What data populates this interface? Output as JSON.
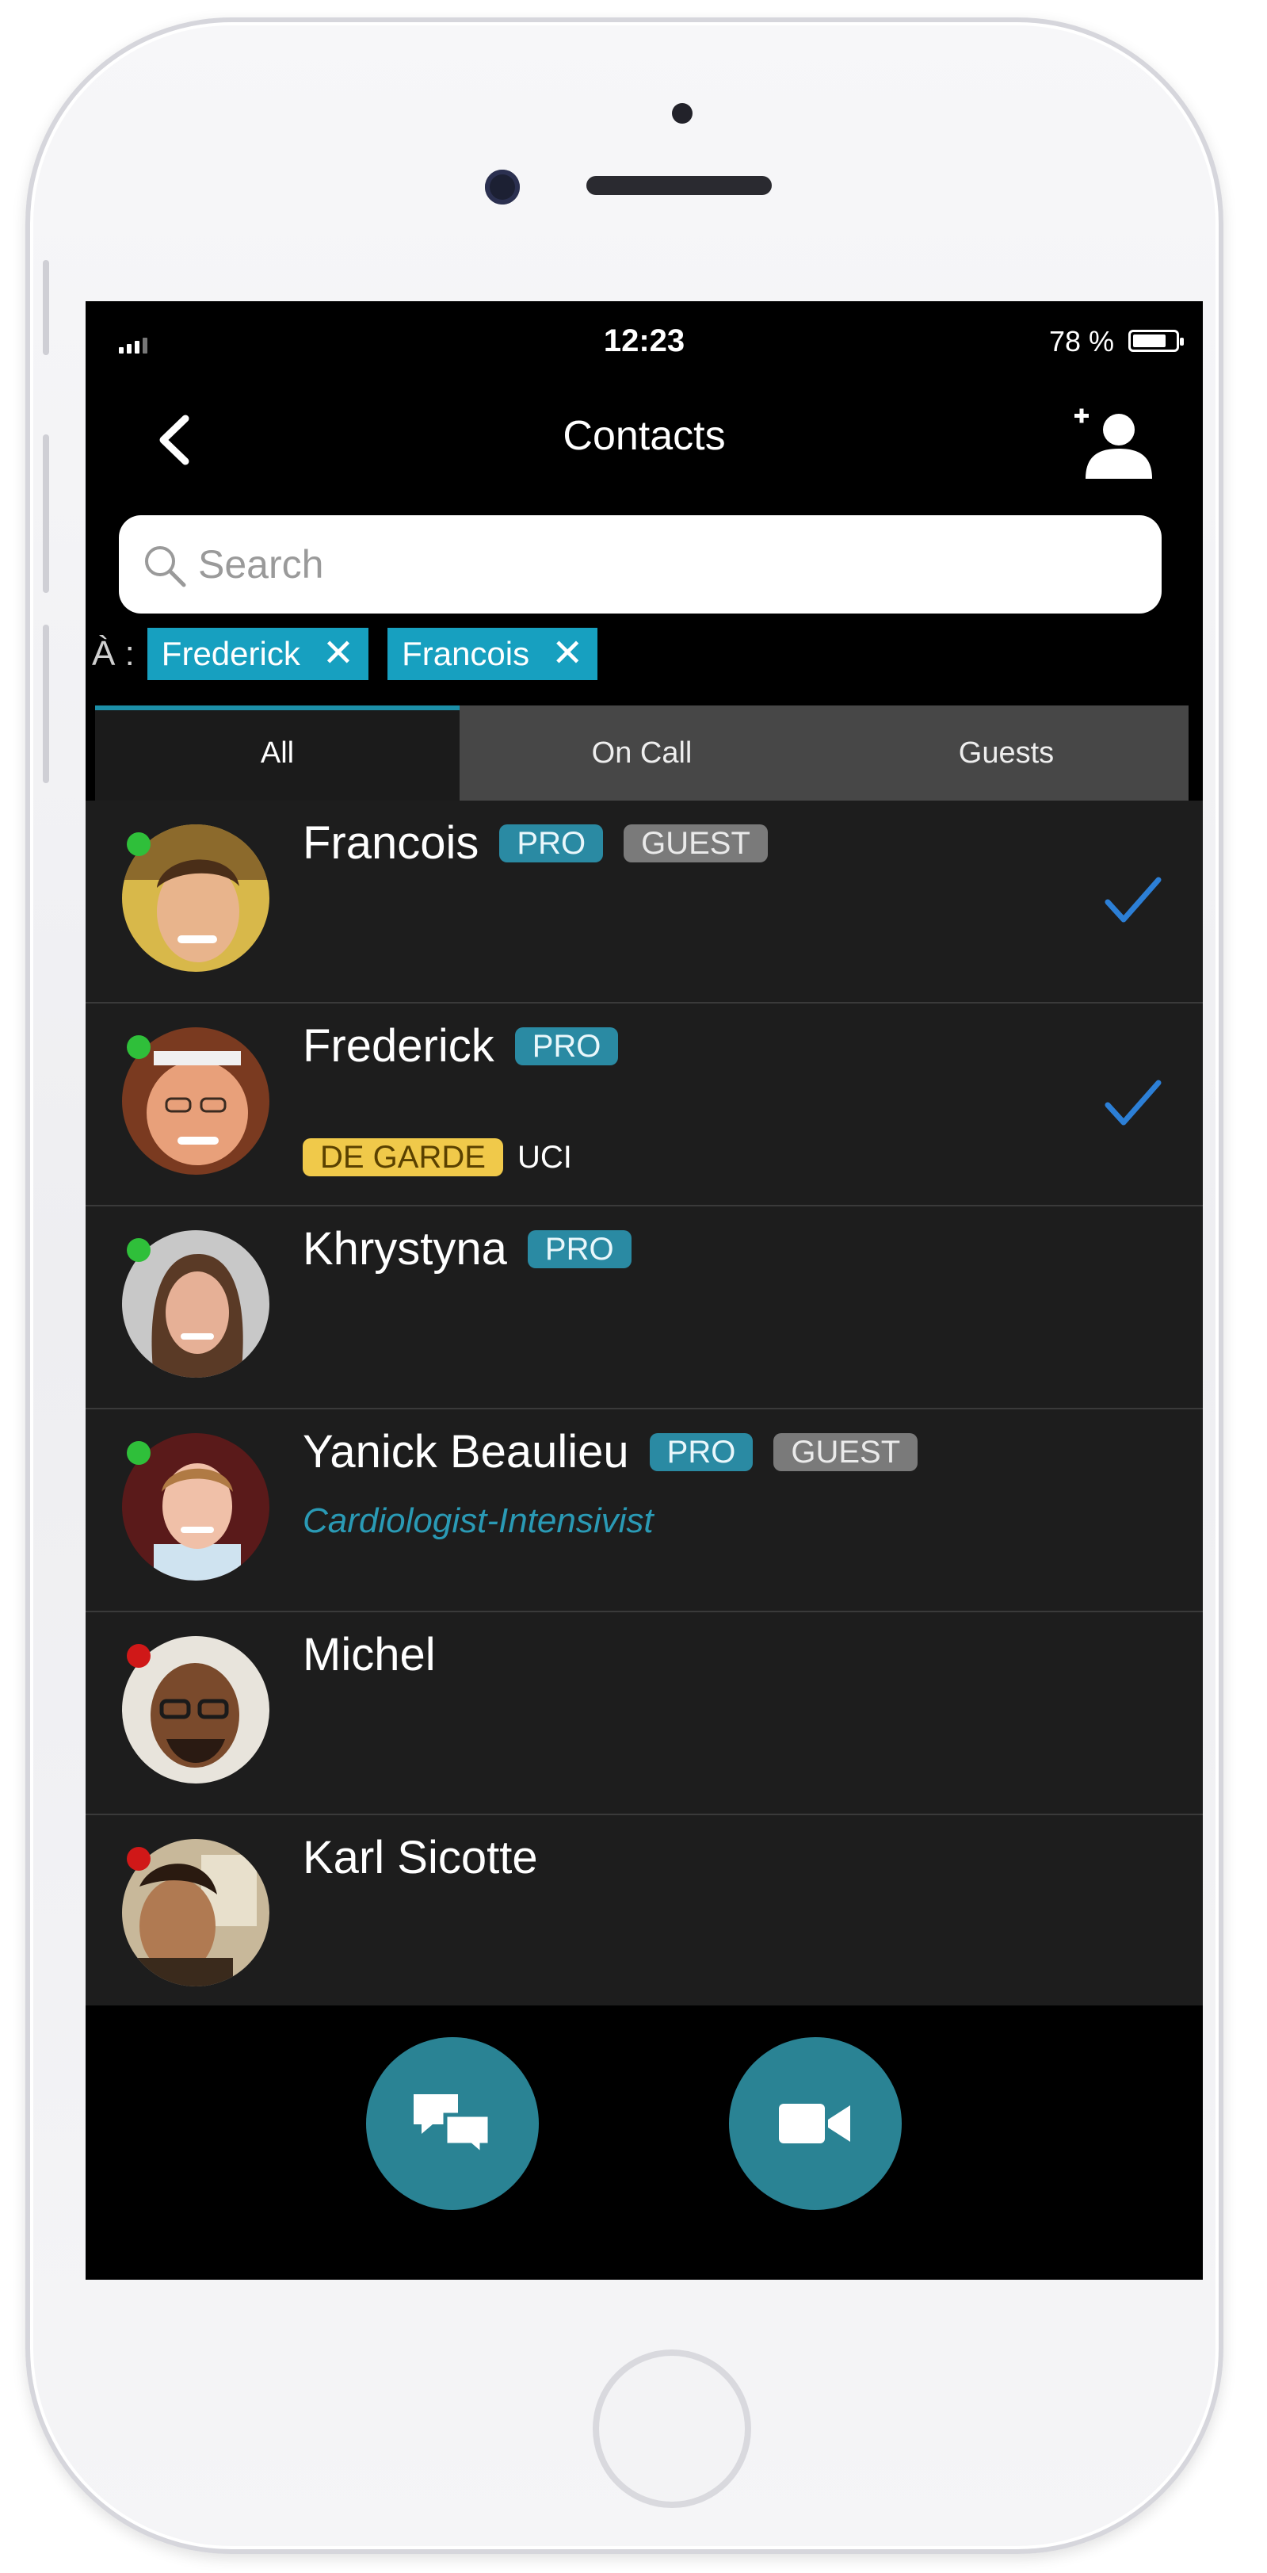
{
  "status_bar": {
    "time": "12:23",
    "battery": "78 %",
    "battery_level": 0.78
  },
  "nav": {
    "title": "Contacts"
  },
  "search": {
    "placeholder": "Search"
  },
  "recipients": {
    "label": "À :",
    "chips": [
      "Frederick",
      "Francois"
    ]
  },
  "tabs": [
    {
      "label": "All",
      "active": true
    },
    {
      "label": "On Call",
      "active": false
    },
    {
      "label": "Guests",
      "active": false
    }
  ],
  "contacts": [
    {
      "name": "Francois",
      "status": "online",
      "badges": [
        "PRO",
        "GUEST"
      ],
      "selected": true
    },
    {
      "name": "Frederick",
      "status": "online",
      "badges": [
        "PRO"
      ],
      "oncall": "DE GARDE",
      "unit": "UCI",
      "selected": true
    },
    {
      "name": "Khrystyna",
      "status": "online",
      "badges": [
        "PRO"
      ],
      "selected": false
    },
    {
      "name": "Yanick Beaulieu",
      "status": "online",
      "badges": [
        "PRO",
        "GUEST"
      ],
      "subtitle": "Cardiologist-Intensivist",
      "selected": false
    },
    {
      "name": "Michel",
      "status": "offline",
      "badges": [],
      "selected": false
    },
    {
      "name": "Karl Sicotte",
      "status": "offline",
      "badges": [],
      "selected": false
    }
  ],
  "colors": {
    "accent": "#17a0c0",
    "pro_badge": "#2a8aa3",
    "guest_badge": "#7a7a7a",
    "oncall_badge": "#f0c94a",
    "online": "#2fbf3a",
    "offline": "#d01818",
    "check": "#2c7fd6"
  },
  "icons": {
    "back": "chevron-left-icon",
    "add_contact": "add-person-icon",
    "search": "magnifier-icon",
    "remove_chip": "close-icon",
    "selected": "checkmark-icon",
    "chat": "chat-bubbles-icon",
    "video": "video-camera-icon"
  }
}
